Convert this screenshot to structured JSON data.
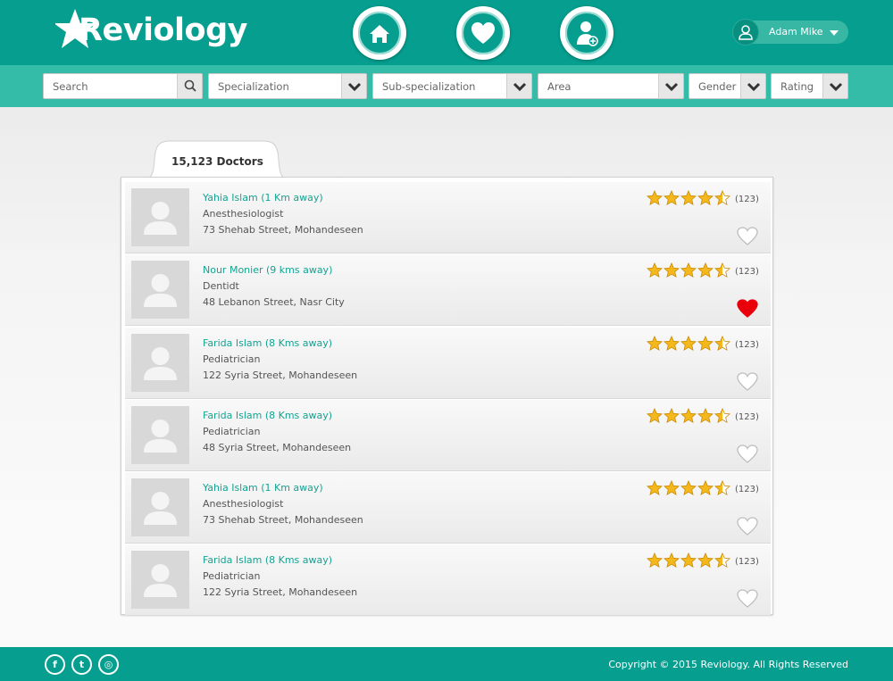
{
  "brand": {
    "name": "Reviology"
  },
  "nav": [
    {
      "id": "home",
      "icon": "home-icon"
    },
    {
      "id": "favorites",
      "icon": "heart-icon"
    },
    {
      "id": "doctors",
      "icon": "doctor-icon"
    }
  ],
  "user": {
    "name": "Adam Mike",
    "icon": "user-icon"
  },
  "filters": {
    "search": "Search",
    "specialization": "Specialization",
    "sub_specialization": "Sub-specialization",
    "area": "Area",
    "gender": "Gender",
    "rating": "Rating"
  },
  "results": {
    "tab_label": "15,123 Doctors",
    "doctors": [
      {
        "name": "Yahia Islam (1 Km away)",
        "specialty": "Anesthesiologist",
        "address": "73 Shehab Street, Mohandeseen",
        "rating": 4.5,
        "reviews": "(123)",
        "favorite": false
      },
      {
        "name": "Nour Monier (9 kms away)",
        "specialty": "Dentidt",
        "address": "48 Lebanon Street, Nasr City",
        "rating": 4.5,
        "reviews": "(123)",
        "favorite": true
      },
      {
        "name": "Farida Islam (8 Kms away)",
        "specialty": "Pediatrician",
        "address": "122 Syria Street, Mohandeseen",
        "rating": 4.5,
        "reviews": "(123)",
        "favorite": false
      },
      {
        "name": "Farida Islam (8 Kms away)",
        "specialty": "Pediatrician",
        "address": "48 Syria Street, Mohandeseen",
        "rating": 4.5,
        "reviews": "(123)",
        "favorite": false
      },
      {
        "name": "Yahia Islam (1 Km away)",
        "specialty": "Anesthesiologist",
        "address": "73 Shehab Street, Mohandeseen",
        "rating": 4.5,
        "reviews": "(123)",
        "favorite": false
      },
      {
        "name": "Farida Islam (8 Kms away)",
        "specialty": "Pediatrician",
        "address": "122 Syria Street, Mohandeseen",
        "rating": 4.5,
        "reviews": "(123)",
        "favorite": false
      }
    ]
  },
  "footer": {
    "social": [
      {
        "label": "f",
        "icon": "facebook-icon"
      },
      {
        "label": "t",
        "icon": "twitter-icon"
      },
      {
        "label": "◎",
        "icon": "instagram-icon"
      }
    ],
    "copyright": "Copyright © 2015 Reviology. All Rights Reserved"
  },
  "colors": {
    "primary": "#059e8f",
    "secondary": "#35bca8",
    "link": "#14a391",
    "star": "#f5b81c",
    "heart_active": "#e8000b",
    "heart_inactive": "#ffffff"
  }
}
